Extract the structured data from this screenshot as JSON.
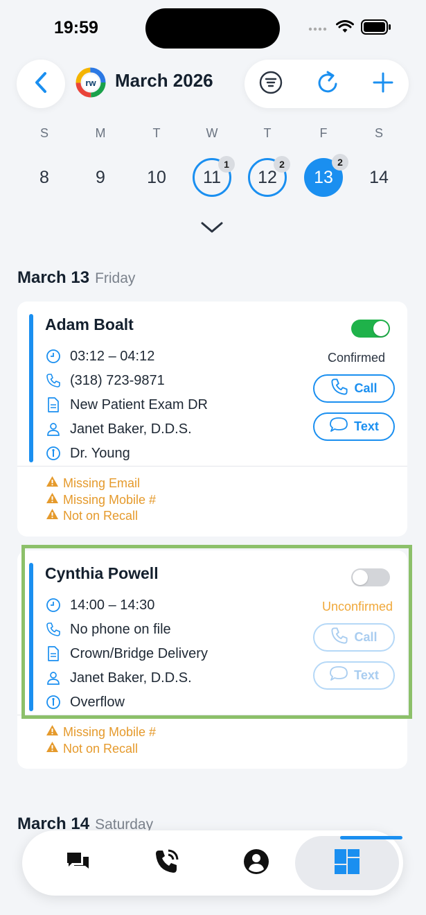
{
  "status_bar": {
    "time": "19:59"
  },
  "header": {
    "title": "March 2026",
    "logo_text": "rw"
  },
  "week": {
    "days_of_week": [
      "S",
      "M",
      "T",
      "W",
      "T",
      "F",
      "S"
    ],
    "dates": [
      {
        "num": "8",
        "badge": null,
        "style": "plain"
      },
      {
        "num": "9",
        "badge": null,
        "style": "plain"
      },
      {
        "num": "10",
        "badge": null,
        "style": "plain"
      },
      {
        "num": "11",
        "badge": "1",
        "style": "ring"
      },
      {
        "num": "12",
        "badge": "2",
        "style": "ring"
      },
      {
        "num": "13",
        "badge": "2",
        "style": "selected"
      },
      {
        "num": "14",
        "badge": null,
        "style": "plain"
      }
    ]
  },
  "sections": [
    {
      "date": "March 13",
      "weekday": "Friday",
      "appointments": [
        {
          "name": "Adam Boalt",
          "time": "03:12 – 04:12",
          "phone": "(318) 723-9871",
          "procedure": "New Patient Exam DR",
          "provider": "Janet Baker, D.D.S.",
          "operatory": "Dr. Young",
          "confirmed": true,
          "status": "Confirmed",
          "call_label": "Call",
          "text_label": "Text",
          "warnings": [
            "Missing Email",
            "Missing Mobile #",
            "Not on Recall"
          ]
        },
        {
          "name": "Cynthia Powell",
          "time": "14:00 – 14:30",
          "phone": "No phone on file",
          "procedure": "Crown/Bridge Delivery",
          "provider": "Janet Baker, D.D.S.",
          "operatory": "Overflow",
          "confirmed": false,
          "status": "Unconfirmed",
          "call_label": "Call",
          "text_label": "Text",
          "warnings": [
            "Missing Mobile #",
            "Not on Recall"
          ]
        }
      ]
    },
    {
      "date": "March 14",
      "weekday": "Saturday",
      "appointments": []
    }
  ],
  "colors": {
    "accent": "#1a8ff0",
    "confirmed_toggle": "#1fb24a",
    "warning": "#e59a2c",
    "highlight": "#8cc06a"
  },
  "icons": {
    "nav": [
      "messages-icon",
      "phone-calls-icon",
      "profile-icon",
      "dashboard-icon"
    ]
  }
}
